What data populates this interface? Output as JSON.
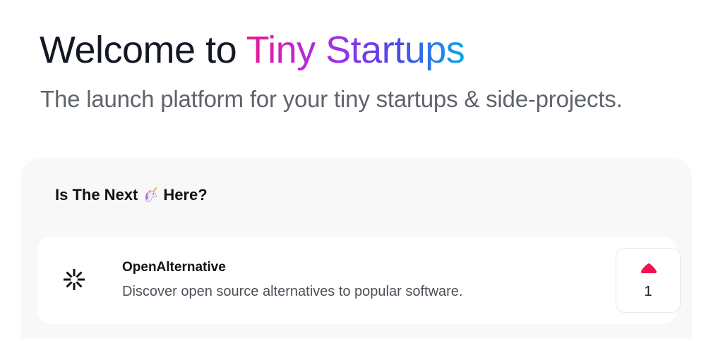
{
  "hero": {
    "title_prefix": "Welcome to ",
    "title_brand": "Tiny Startups",
    "subtitle": "The launch platform for your tiny startups & side-projects."
  },
  "section": {
    "heading_before": "Is The Next",
    "heading_icon": "unicorn-icon",
    "heading_after": "Here?"
  },
  "products": [
    {
      "name": "OpenAlternative",
      "description": "Discover open source alternatives to popular software.",
      "logo_icon": "asterisk-logo-icon",
      "upvotes": "1"
    }
  ],
  "colors": {
    "brand_gradient": [
      "#ec1a8c",
      "#9333ea",
      "#4f46e5",
      "#0ea5e9"
    ],
    "upvote": "#f0134d",
    "panel_bg": "#f8f8f8"
  }
}
